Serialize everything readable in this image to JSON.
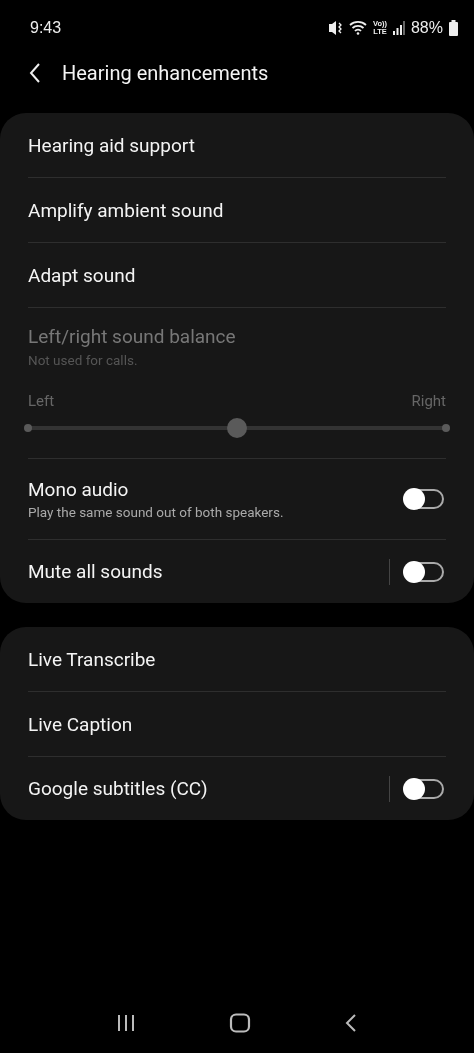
{
  "status_bar": {
    "time": "9:43",
    "network_top": "Vo))",
    "network_bottom": "LTE",
    "battery": "88%"
  },
  "header": {
    "title": "Hearing enhancements"
  },
  "groups": [
    {
      "items": [
        {
          "kind": "link",
          "label": "Hearing aid support"
        },
        {
          "kind": "link",
          "label": "Amplify ambient sound"
        },
        {
          "kind": "link",
          "label": "Adapt sound"
        },
        {
          "kind": "balance",
          "label": "Left/right sound balance",
          "subtitle": "Not used for calls.",
          "disabled": true,
          "left_label": "Left",
          "right_label": "Right",
          "level": 0.5
        },
        {
          "kind": "toggle",
          "label": "Mono audio",
          "subtitle": "Play the same sound out of both speakers.",
          "on": false,
          "split": false
        },
        {
          "kind": "toggle",
          "label": "Mute all sounds",
          "on": false,
          "split": true
        }
      ]
    },
    {
      "items": [
        {
          "kind": "link",
          "label": "Live Transcribe"
        },
        {
          "kind": "link",
          "label": "Live Caption"
        },
        {
          "kind": "toggle",
          "label": "Google subtitles (CC)",
          "on": false,
          "split": true
        }
      ]
    }
  ]
}
